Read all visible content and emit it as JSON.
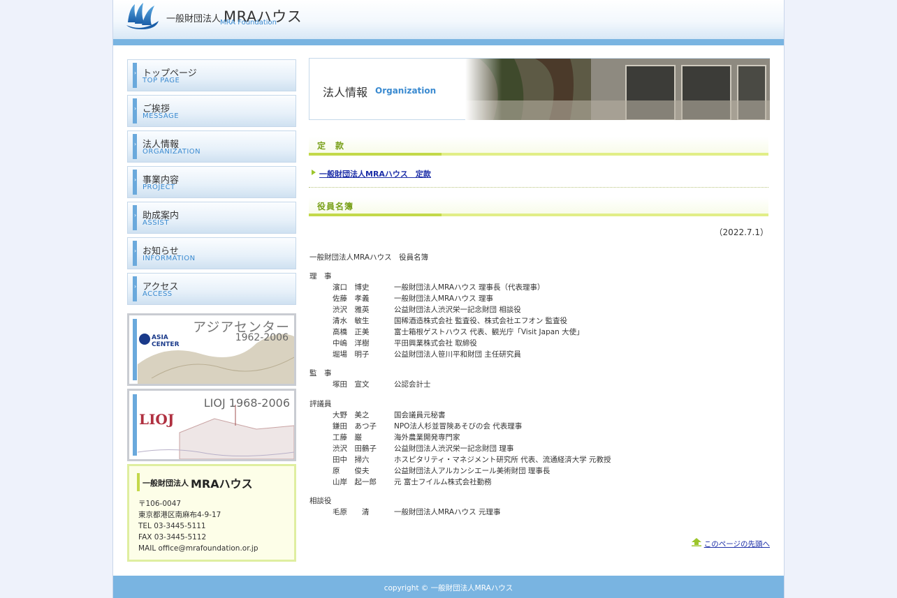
{
  "header": {
    "brand_prefix": "一般財団法人",
    "brand_name": "MRAハウス",
    "brand_en": "MRA Foundation"
  },
  "nav": [
    {
      "jp": "トップページ",
      "en": "TOP PAGE"
    },
    {
      "jp": "ご挨拶",
      "en": "MESSAGE"
    },
    {
      "jp": "法人情報",
      "en": "ORGANIZATION"
    },
    {
      "jp": "事業内容",
      "en": "PROJECT"
    },
    {
      "jp": "助成案内",
      "en": "ASSIST"
    },
    {
      "jp": "お知らせ",
      "en": "INFORMATION"
    },
    {
      "jp": "アクセス",
      "en": "ACCESS"
    }
  ],
  "banners": {
    "asia": {
      "title": "アジアセンター",
      "years": "1962-2006",
      "logo": "ASIA CENTER"
    },
    "lioj": {
      "title": "LIOJ",
      "years": "1968-2006",
      "logo": "LIOJ"
    }
  },
  "contact": {
    "org": "一般財団法人",
    "name": "MRAハウス",
    "postal": "〒106-0047",
    "address": "東京都港区南麻布4-9-17",
    "tel": "TEL 03-3445-5111",
    "fax": "FAX 03-3445-5112",
    "mail": "MAIL office@mrafoundation.or.jp"
  },
  "page_head": {
    "title": "法人情報",
    "title_en": "Organization"
  },
  "sections": {
    "teikan": "定　款",
    "yakuin": "役員名簿"
  },
  "teikan_link": "一般財団法人MRAハウス　定款",
  "date": "（2022.7.1）",
  "roster_title": "一般財団法人MRAハウス　役員名簿",
  "roster": {
    "riji": {
      "label": "理　事",
      "members": [
        {
          "name": "濱口　博史",
          "position": "一般財団法人MRAハウス 理事長（代表理事）"
        },
        {
          "name": "佐藤　孝義",
          "position": "一般財団法人MRAハウス 理事"
        },
        {
          "name": "渋沢　雅英",
          "position": "公益財団法人渋沢栄一記念財団 相談役"
        },
        {
          "name": "清水　敏生",
          "position": "国稀酒造株式会社 監査役、株式会社エフオン 監査役"
        },
        {
          "name": "高橋　正美",
          "position": "富士箱根ゲストハウス 代表、観光庁「Visit Japan 大使」"
        },
        {
          "name": "中嶋　洋樹",
          "position": "平田興業株式会社 取締役"
        },
        {
          "name": "堀場　明子",
          "position": "公益財団法人笹川平和財団 主任研究員"
        }
      ]
    },
    "kanji": {
      "label": "監　事",
      "members": [
        {
          "name": "塚田　宣文",
          "position": "公認会計士"
        }
      ]
    },
    "hyogiin": {
      "label": "評議員",
      "members": [
        {
          "name": "大野　美之",
          "position": "国会議員元秘書"
        },
        {
          "name": "鎌田　あつ子",
          "position": "NPO法人杉並冒険あそびの会 代表理事"
        },
        {
          "name": "工藤　巌",
          "position": "海外農業開発専門家"
        },
        {
          "name": "渋沢　田鶴子",
          "position": "公益財団法人渋沢栄一記念財団 理事"
        },
        {
          "name": "田中　掃六",
          "position": "ホスピタリティ・マネジメント研究所 代表、流通経済大学 元教授"
        },
        {
          "name": "原　　俊夫",
          "position": "公益財団法人アルカンシエール美術財団 理事長"
        },
        {
          "name": "山岸　起一郎",
          "position": "元 富士フイルム株式会社勤務"
        }
      ]
    },
    "sodanyaku": {
      "label": "相談役",
      "members": [
        {
          "name": "毛原　　清",
          "position": "一般財団法人MRAハウス 元理事"
        }
      ]
    }
  },
  "to_top": "このページの先頭へ",
  "footer": "copyright © 一般財団法人MRAハウス",
  "colors": {
    "accent_blue": "#79b4e1",
    "link_blue": "#3a8ad0",
    "section_green": "#7aa11c",
    "contact_border": "#dfeea0"
  }
}
